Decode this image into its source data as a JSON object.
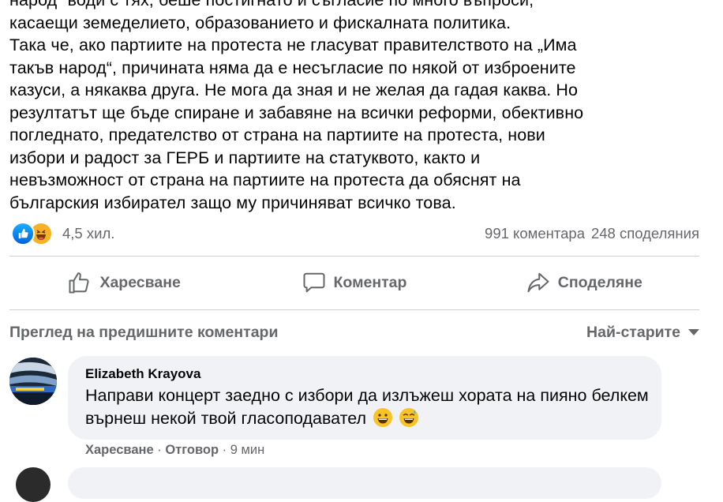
{
  "post": {
    "lines": [
      "народ“ води с тях, беше постигнато и съгласие по много въпроси,",
      "касаещи земеделието, образованието и фискалната политика.",
      "Така че, ако партиите на протеста не гласуват правителството на „Има",
      "такъв народ“, причината няма да е несъгласие по някой от изброените",
      "казуси, а някаква друга. Не мога да зная и не желая да гадая каква. Но",
      "резултатът ще бъде спиране и забавяне на всички реформи, обективно",
      "погледнато, предателство от страна на партиите на протеста, нови",
      "избори и радост за ГЕРБ и партиите на статуквото, както и",
      "невъзможност от страна на партиите на протеста да обяснят на",
      "българския избирател защо му причиняват всичко това."
    ]
  },
  "reactions": {
    "icons": [
      "like-icon",
      "haha-icon"
    ],
    "count": "4,5 хил.",
    "comments": "991 коментара",
    "shares": "248 споделяния"
  },
  "actions": {
    "like": "Харесване",
    "comment": "Коментар",
    "share": "Споделяне"
  },
  "comments_bar": {
    "previous": "Преглед на предишните коментари",
    "sort": "Най-старите"
  },
  "comment": {
    "author": "Elizabeth Krayova",
    "text": "Направи концерт заедно с избори да излъжеш хората на пияно белкем върнеш некой твой гласоподавател",
    "emojis": [
      "grinning-face-icon",
      "grinning-sweat-icon"
    ],
    "like_label": "Харесване",
    "reply_label": "Отговор",
    "time": "9 мин"
  },
  "colors": {
    "like_blue": "#1877f2",
    "secondary_text": "#65676b",
    "bubble": "#f0f2f5"
  }
}
